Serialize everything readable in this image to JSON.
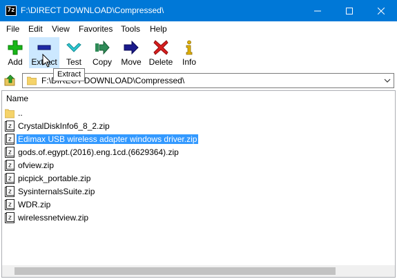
{
  "window": {
    "title": "F:\\DIRECT DOWNLOAD\\Compressed\\",
    "app_icon_text": "7z"
  },
  "menu": [
    "File",
    "Edit",
    "View",
    "Favorites",
    "Tools",
    "Help"
  ],
  "toolbar": {
    "buttons": [
      {
        "label": "Add",
        "icon": "plus-icon",
        "color": "#17b717"
      },
      {
        "label": "Extract",
        "icon": "minus-icon",
        "color": "#1e2aa6"
      },
      {
        "label": "Test",
        "icon": "check-icon",
        "color": "#2ec9d3"
      },
      {
        "label": "Copy",
        "icon": "copy-arrow-icon",
        "color": "#2e8b57"
      },
      {
        "label": "Move",
        "icon": "move-arrow-icon",
        "color": "#1a1a8c"
      },
      {
        "label": "Delete",
        "icon": "delete-x-icon",
        "color": "#d81e1e"
      },
      {
        "label": "Info",
        "icon": "info-icon",
        "color": "#e0b000"
      }
    ],
    "hovered": "Extract"
  },
  "tooltip": "Extract",
  "address": {
    "path": "F:\\DIRECT DOWNLOAD\\Compressed\\"
  },
  "list": {
    "column_header": "Name",
    "items": [
      {
        "name": "..",
        "type": "folder"
      },
      {
        "name": "CrystalDiskInfo6_8_2.zip",
        "type": "zip"
      },
      {
        "name": "Edimax USB wireless adapter windows driver.zip",
        "type": "zip",
        "selected": true
      },
      {
        "name": "gods.of.egypt.(2016).eng.1cd.(6629364).zip",
        "type": "zip"
      },
      {
        "name": "ofview.zip",
        "type": "zip"
      },
      {
        "name": "picpick_portable.zip",
        "type": "zip"
      },
      {
        "name": "SysinternalsSuite.zip",
        "type": "zip"
      },
      {
        "name": "WDR.zip",
        "type": "zip"
      },
      {
        "name": "wirelessnetview.zip",
        "type": "zip"
      }
    ]
  },
  "colors": {
    "titlebar": "#0078d7",
    "selection": "#3399ff",
    "hover": "#cce8ff"
  }
}
